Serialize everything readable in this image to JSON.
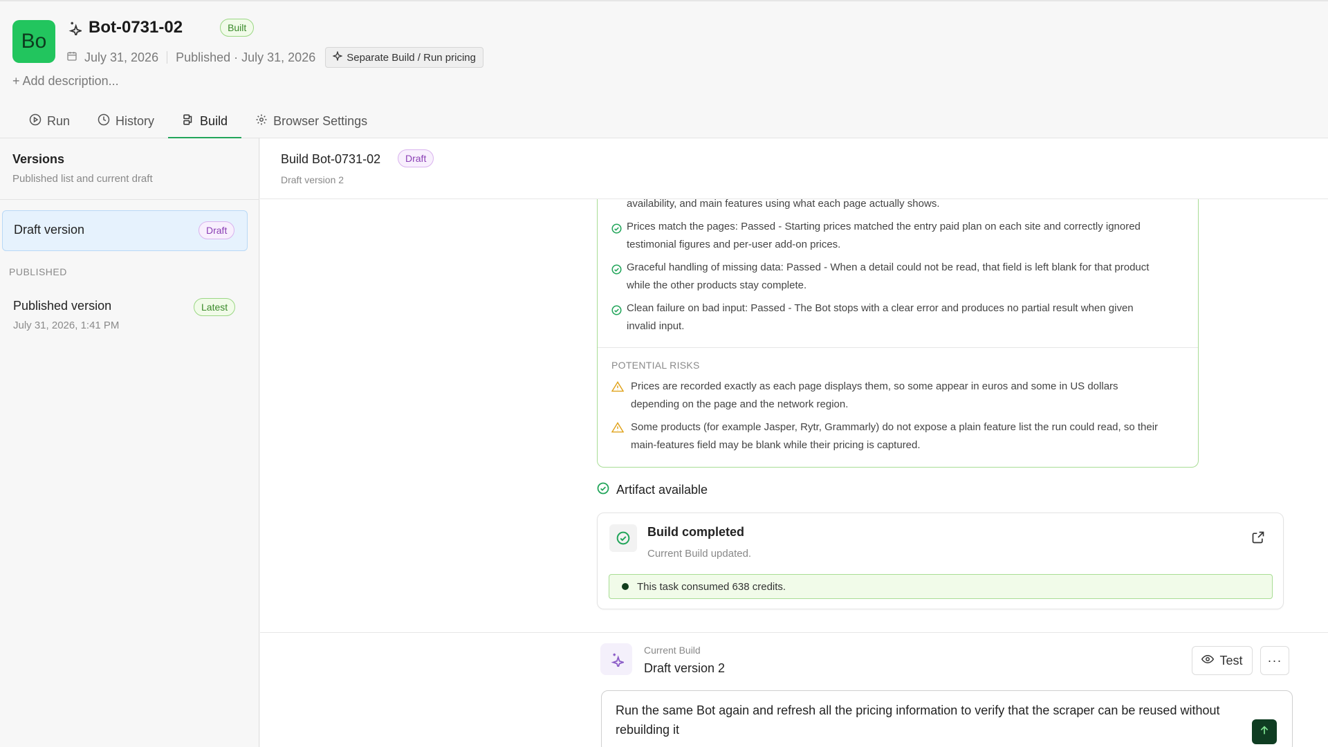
{
  "app": {
    "avatar_initials": "Bo",
    "title": "Bot-0731-02",
    "status_badge": "Built",
    "date": "July 31, 2026",
    "published": "Published · July 31, 2026",
    "pricing_pill": "Separate Build / Run pricing",
    "add_description": "+ Add description...",
    "accent_color": "#22a55a"
  },
  "tabs": [
    {
      "label": "Run",
      "icon": "play-circle-icon"
    },
    {
      "label": "History",
      "icon": "clock-icon"
    },
    {
      "label": "Build",
      "icon": "build-icon",
      "active": true
    },
    {
      "label": "Browser Settings",
      "icon": "gear-icon"
    }
  ],
  "sidebar": {
    "title": "Versions",
    "subtitle": "Published list and current draft",
    "draft": {
      "label": "Draft version",
      "badge": "Draft"
    },
    "published_heading": "PUBLISHED",
    "published_item": {
      "label": "Published version",
      "date": "July 31, 2026, 1:41 PM",
      "badge": "Latest"
    }
  },
  "main": {
    "title": "Build Bot-0731-02",
    "badge": "Draft",
    "subtitle": "Draft version 2"
  },
  "report": {
    "truncated_line": "availability, and main features using what each page actually shows.",
    "checks": [
      {
        "line1": "Prices match the pages: Passed - Starting prices matched the entry paid plan on each site and correctly ignored",
        "line2": "testimonial figures and per-user add-on prices."
      },
      {
        "line1": "Graceful handling of missing data: Passed - When a detail could not be read, that field is left blank for that product",
        "line2": "while the other products stay complete."
      },
      {
        "line1": "Clean failure on bad input: Passed - The Bot stops with a clear error and produces no partial result when given",
        "line2": "invalid input."
      }
    ],
    "risks_heading": "POTENTIAL RISKS",
    "risks": [
      {
        "line1": "Prices are recorded exactly as each page displays them, so some appear in euros and some in US dollars",
        "line2": "depending on the page and the network region."
      },
      {
        "line1": "Some products (for example Jasper, Rytr, Grammarly) do not expose a plain feature list the run could read, so their",
        "line2": "main-features field may be blank while their pricing is captured."
      }
    ]
  },
  "artifact": {
    "label": "Artifact available"
  },
  "build_card": {
    "title": "Build completed",
    "subtitle": "Current Build updated.",
    "credits": "This task consumed 638 credits."
  },
  "footer": {
    "label": "Current Build",
    "value": "Draft version 2",
    "test_label": "Test",
    "more_label": "···",
    "prompt_value": "Run the same Bot again and refresh all the pricing information to verify that the scraper can be reused without rebuilding it"
  }
}
